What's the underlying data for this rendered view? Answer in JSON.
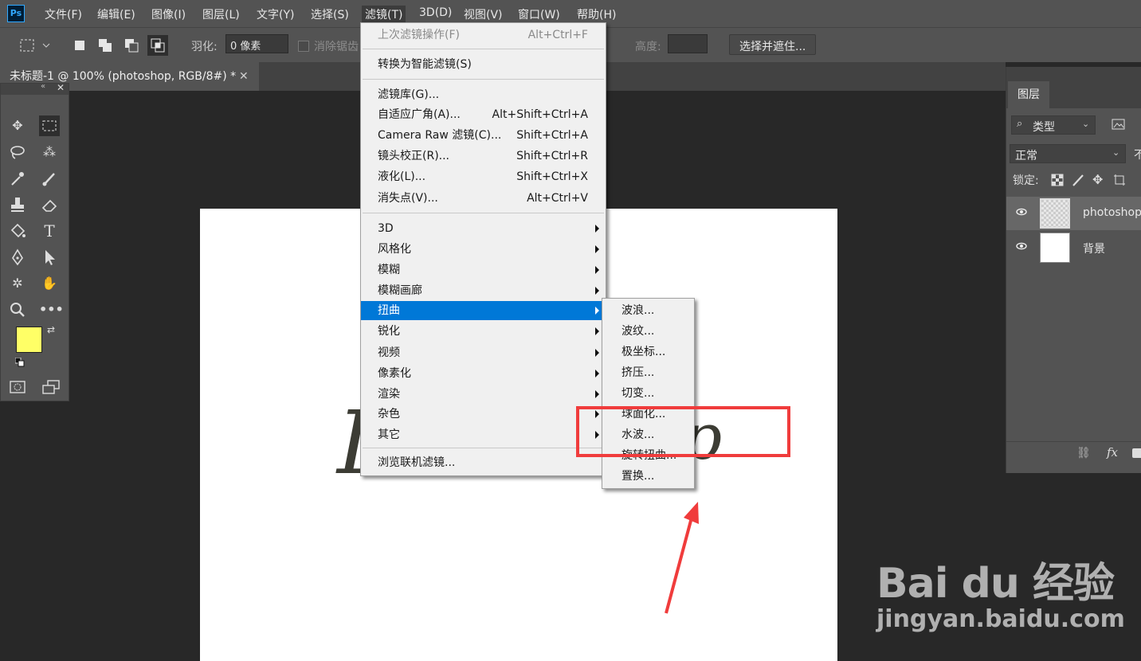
{
  "app": {
    "logo": "Ps"
  },
  "menubar": {
    "items": [
      "文件(F)",
      "编辑(E)",
      "图像(I)",
      "图层(L)",
      "文字(Y)",
      "选择(S)",
      "滤镜(T)",
      "3D(D)",
      "视图(V)",
      "窗口(W)",
      "帮助(H)"
    ],
    "active": "滤镜(T)"
  },
  "optionsbar": {
    "feather_label": "羽化:",
    "feather_value": "0 像素",
    "antialias_label": "消除锯齿",
    "height_label": "高度:",
    "select_mask_button": "选择并遮住..."
  },
  "document": {
    "tab_title": "未标题-1 @ 100% (photoshop, RGB/8#) *",
    "canvas_text_partial": "I",
    "canvas_text_right": "p"
  },
  "colors": {
    "foreground": "#ffff66",
    "background": "#ffffff",
    "highlight": "#0078d7",
    "annotation": "#f03c3c"
  },
  "filter_menu": {
    "items": [
      {
        "label": "上次滤镜操作(F)",
        "shortcut": "Alt+Ctrl+F",
        "disabled": true
      },
      {
        "label": "转换为智能滤镜(S)"
      },
      {
        "label": "滤镜库(G)..."
      },
      {
        "label": "自适应广角(A)...",
        "shortcut": "Alt+Shift+Ctrl+A"
      },
      {
        "label": "Camera Raw 滤镜(C)...",
        "shortcut": "Shift+Ctrl+A"
      },
      {
        "label": "镜头校正(R)...",
        "shortcut": "Shift+Ctrl+R"
      },
      {
        "label": "液化(L)...",
        "shortcut": "Shift+Ctrl+X"
      },
      {
        "label": "消失点(V)...",
        "shortcut": "Alt+Ctrl+V"
      },
      {
        "label": "3D",
        "submenu": true
      },
      {
        "label": "风格化",
        "submenu": true
      },
      {
        "label": "模糊",
        "submenu": true
      },
      {
        "label": "模糊画廊",
        "submenu": true
      },
      {
        "label": "扭曲",
        "submenu": true,
        "highlighted": true
      },
      {
        "label": "锐化",
        "submenu": true
      },
      {
        "label": "视频",
        "submenu": true
      },
      {
        "label": "像素化",
        "submenu": true
      },
      {
        "label": "渲染",
        "submenu": true
      },
      {
        "label": "杂色",
        "submenu": true
      },
      {
        "label": "其它",
        "submenu": true
      },
      {
        "label": "浏览联机滤镜..."
      }
    ]
  },
  "distort_submenu": {
    "items": [
      "波浪...",
      "波纹...",
      "极坐标...",
      "挤压...",
      "切变...",
      "球面化...",
      "水波...",
      "旋转扭曲...",
      "置换..."
    ]
  },
  "layers_panel": {
    "tab": "图层",
    "filter_kind": "类型",
    "blend_mode": "正常",
    "opacity_label_partial": "不",
    "lock_label": "锁定:",
    "layers": [
      {
        "name": "photoshop",
        "selected": true
      },
      {
        "name": "背景",
        "selected": false
      }
    ],
    "footer_fx": "fx"
  },
  "watermark": {
    "logo": "Bai du 经验",
    "url": "jingyan.baidu.com"
  }
}
